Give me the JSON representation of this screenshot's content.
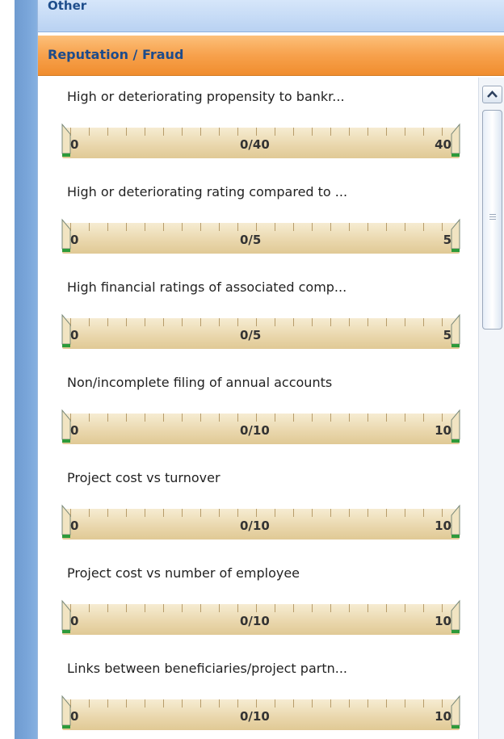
{
  "sections": {
    "other_label": "Other",
    "reputation_label": "Reputation / Fraud"
  },
  "items": [
    {
      "label": "High or deteriorating propensity to bankr...",
      "value": "0/40",
      "min": "0",
      "max": "40"
    },
    {
      "label": "High or deteriorating rating compared to ...",
      "value": "0/5",
      "min": "0",
      "max": "5"
    },
    {
      "label": "High financial ratings of associated comp...",
      "value": "0/5",
      "min": "0",
      "max": "5"
    },
    {
      "label": "Non/incomplete filing of annual accounts",
      "value": "0/10",
      "min": "0",
      "max": "10"
    },
    {
      "label": "Project cost vs turnover",
      "value": "0/10",
      "min": "0",
      "max": "10"
    },
    {
      "label": "Project cost vs number of employee",
      "value": "0/10",
      "min": "0",
      "max": "10"
    },
    {
      "label": "Links between beneficiaries/project partn...",
      "value": "0/10",
      "min": "0",
      "max": "10"
    }
  ],
  "icons": {
    "scroll_up": "chevron-up-icon",
    "thumb_grip": "grip-icon"
  },
  "colors": {
    "section_other": "#c6dbf5",
    "section_reputation": "#f7a14c",
    "track": "#e9d6ab",
    "thumb_marker": "#2d9a3a"
  }
}
